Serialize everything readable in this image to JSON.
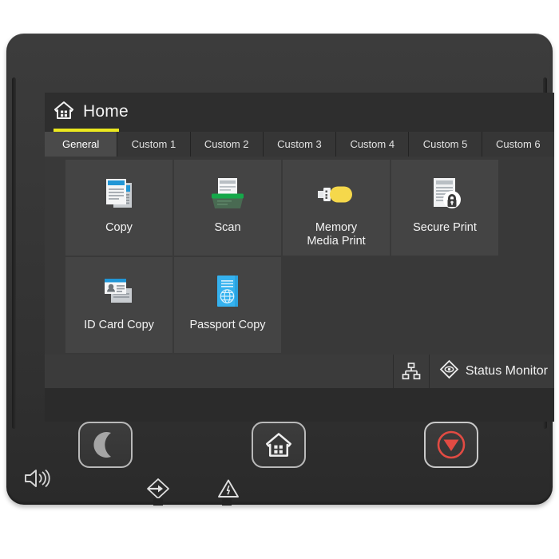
{
  "device": {
    "name": "printer-control-panel"
  },
  "screen": {
    "header": {
      "home_icon": "home-house-grid-icon",
      "title": "Home",
      "accent_color": "#ebe81f"
    },
    "tabs": [
      {
        "label": "General",
        "active": true
      },
      {
        "label": "Custom 1",
        "active": false
      },
      {
        "label": "Custom 2",
        "active": false
      },
      {
        "label": "Custom 3",
        "active": false
      },
      {
        "label": "Custom 4",
        "active": false
      },
      {
        "label": "Custom 5",
        "active": false
      },
      {
        "label": "Custom 6",
        "active": false
      }
    ],
    "tiles": [
      {
        "label": "Copy",
        "icon": "copy-documents-icon",
        "accent": "#2196d6",
        "empty": false
      },
      {
        "label": "Scan",
        "icon": "scanner-icon",
        "accent": "#16a84a",
        "empty": false
      },
      {
        "label": "Memory\nMedia Print",
        "icon": "usb-drive-icon",
        "accent": "#f5d84b",
        "empty": false
      },
      {
        "label": "Secure Print",
        "icon": "document-lock-icon",
        "accent": "#d8d8d8",
        "empty": false
      },
      {
        "label": "ID Card Copy",
        "icon": "id-card-icon",
        "accent": "#2196d6",
        "empty": false
      },
      {
        "label": "Passport Copy",
        "icon": "passport-book-icon",
        "accent": "#35b2ef",
        "empty": false
      },
      {
        "label": "",
        "icon": "",
        "accent": "",
        "empty": true
      },
      {
        "label": "",
        "icon": "",
        "accent": "",
        "empty": true
      }
    ],
    "tile_labels": {
      "copy": "Copy",
      "scan": "Scan",
      "memory_media_print_line1": "Memory",
      "memory_media_print_line2": "Media Print",
      "secure_print": "Secure Print",
      "id_card_copy": "ID Card Copy",
      "passport_copy": "Passport Copy"
    },
    "status_bar": {
      "network_icon": "network-ethernet-icon",
      "status_monitor_icon": "status-monitor-diamond-eye-icon",
      "status_monitor_label": "Status Monitor"
    }
  },
  "hardware": {
    "buttons": [
      {
        "name": "sleep-button",
        "icon": "crescent-moon-icon",
        "color": "#b9b9b9"
      },
      {
        "name": "home-button",
        "icon": "home-house-grid-icon",
        "color": "#f0f0f0"
      },
      {
        "name": "stop-button",
        "icon": "stop-triangle-icon",
        "color": "#e24b43"
      }
    ],
    "indicators": [
      {
        "name": "speaker-indicator",
        "icon": "speaker-volume-icon"
      },
      {
        "name": "data-indicator",
        "icon": "data-in-arrow-diamond-icon"
      },
      {
        "name": "error-indicator",
        "icon": "warning-triangle-icon"
      }
    ]
  }
}
